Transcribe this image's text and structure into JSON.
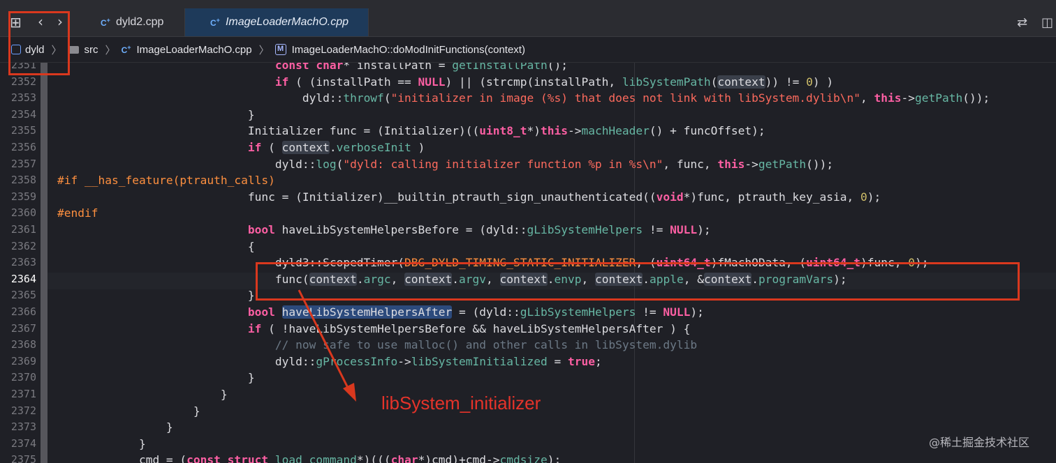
{
  "tabs": [
    {
      "label": "dyld2.cpp",
      "active": false
    },
    {
      "label": "ImageLoaderMachO.cpp",
      "active": true
    }
  ],
  "file_badge": "C",
  "breadcrumbs": [
    "dyld",
    "src",
    "ImageLoaderMachO.cpp",
    "ImageLoaderMachO::doModInitFunctions(context)"
  ],
  "method_badge": "M",
  "current_line": "2364",
  "line_numbers": [
    "2351",
    "2352",
    "2353",
    "2354",
    "2355",
    "2356",
    "2357",
    "2358",
    "2359",
    "2360",
    "2361",
    "2362",
    "2363",
    "2364",
    "2365",
    "2366",
    "2367",
    "2368",
    "2369",
    "2370",
    "2371",
    "2372",
    "2373",
    "2374",
    "2375"
  ],
  "annotation": "libSystem_initializer",
  "watermark": "@稀土掘金技术社区",
  "colors": {
    "highlight_box": "#d9381e",
    "annotation": "#e5332a"
  }
}
